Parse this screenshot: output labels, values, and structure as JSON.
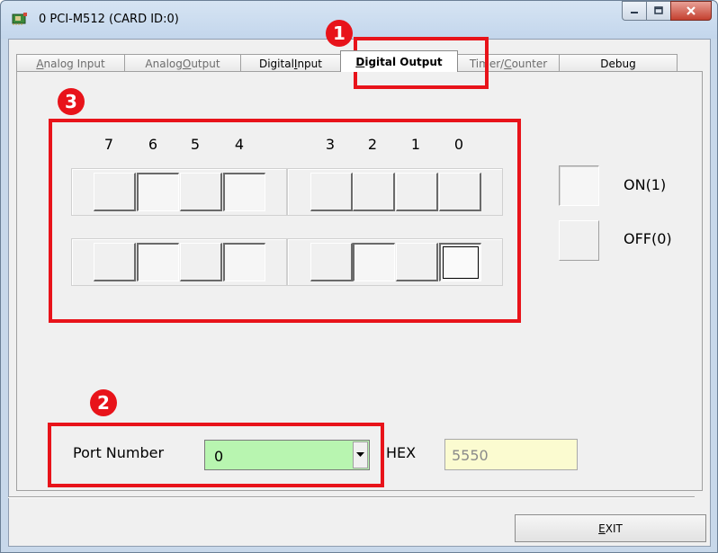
{
  "window": {
    "title": "0 PCI-M512 (CARD ID:0)",
    "icon": "card-chip-icon"
  },
  "title_controls": {
    "minimize": "minimize-icon",
    "maximize": "maximize-icon",
    "close": "close-icon"
  },
  "tabs": [
    {
      "label_prefix": "",
      "mnemonic": "A",
      "label_suffix": "nalog Input",
      "active": false
    },
    {
      "label_prefix": "Analog ",
      "mnemonic": "O",
      "label_suffix": "utput",
      "active": false
    },
    {
      "label_prefix": "Digital ",
      "mnemonic": "I",
      "label_suffix": "nput",
      "active": false
    },
    {
      "label_prefix": "",
      "mnemonic": "D",
      "label_suffix": "igital Output",
      "active": true
    },
    {
      "label_prefix": "Timer/",
      "mnemonic": "C",
      "label_suffix": "ounter",
      "active": false
    },
    {
      "label_prefix": "Debug",
      "mnemonic": "",
      "label_suffix": "",
      "active": false
    }
  ],
  "bit_labels": {
    "high_nibble": [
      "7",
      "6",
      "5",
      "4"
    ],
    "low_nibble": [
      "3",
      "2",
      "1",
      "0"
    ]
  },
  "bit_rows": [
    {
      "high": [
        "off",
        "on",
        "off",
        "on"
      ],
      "low": [
        "off",
        "off",
        "off",
        "off"
      ]
    },
    {
      "high": [
        "off",
        "on",
        "off",
        "on"
      ],
      "low": [
        "off",
        "on",
        "off",
        "on"
      ]
    }
  ],
  "legend": {
    "on_label": "ON(1)",
    "off_label": "OFF(0)"
  },
  "port": {
    "label": "Port Number",
    "selected": "0",
    "hex_label": "HEX",
    "hex_value": "5550"
  },
  "exit": {
    "label_mnemonic": "E",
    "label_rest": "XIT"
  },
  "annotations": {
    "badge_1": "1",
    "badge_2": "2",
    "badge_3": "3",
    "color": "#e8131a"
  }
}
